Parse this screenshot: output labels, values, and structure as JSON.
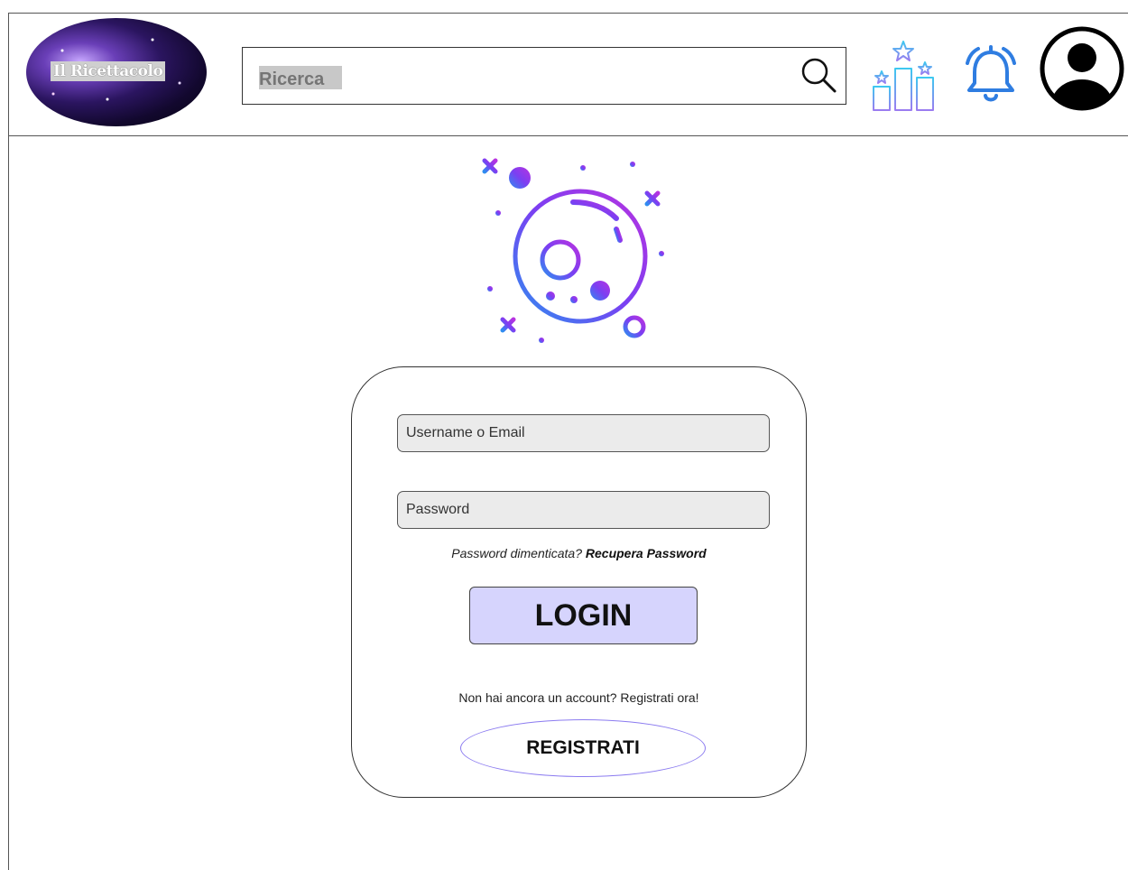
{
  "header": {
    "logo_text": "Il Ricettacolo",
    "search": {
      "placeholder": "Ricerca"
    },
    "icons": [
      "search-icon",
      "ranking-icon",
      "bell-icon",
      "user-avatar-icon"
    ]
  },
  "login": {
    "username_placeholder": "Username o Email",
    "password_placeholder": "Password",
    "forgot_text": "Password dimenticata?",
    "recover_link": "Recupera Password",
    "login_button": "LOGIN",
    "no_account_text": "Non hai ancora un account? Registrati ora!",
    "register_button": "REGISTRATI"
  },
  "colors": {
    "login_button_bg": "#d6d4fd",
    "register_border": "#8c7cf0",
    "bell": "#2f7de1",
    "planet_gradient": [
      "#2f8df0",
      "#7b3ff2",
      "#b833e0"
    ]
  }
}
